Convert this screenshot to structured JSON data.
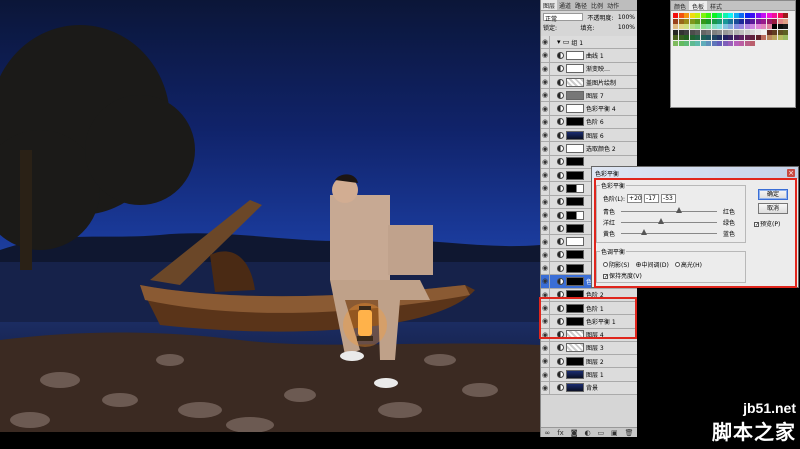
{
  "layers_panel": {
    "tabs": [
      "图层",
      "通道",
      "路径",
      "比例",
      "动作"
    ],
    "blend_mode": "正常",
    "opacity_label": "不透明度:",
    "opacity_value": "100%",
    "lock_label": "锁定:",
    "fill_label": "填充:",
    "fill_value": "100%",
    "layers": [
      {
        "name": "组 1",
        "thumb": "none"
      },
      {
        "name": "曲线 1",
        "thumb": "w"
      },
      {
        "name": "渐变映…",
        "thumb": "w"
      },
      {
        "name": "盖图片绘制",
        "thumb": "chk"
      },
      {
        "name": "图层 7",
        "thumb": "g"
      },
      {
        "name": "色彩平衡 4",
        "thumb": "w"
      },
      {
        "name": "色阶 6",
        "thumb": "b"
      },
      {
        "name": "图层 6",
        "thumb": "img"
      },
      {
        "name": "选取颜色 2",
        "thumb": "w"
      },
      {
        "name": "",
        "thumb": "b"
      },
      {
        "name": "",
        "thumb": "b"
      },
      {
        "name": "",
        "thumb": "mix"
      },
      {
        "name": "",
        "thumb": "b"
      },
      {
        "name": "",
        "thumb": "mix"
      },
      {
        "name": "",
        "thumb": "b"
      },
      {
        "name": "",
        "thumb": "w"
      },
      {
        "name": "",
        "thumb": "b"
      },
      {
        "name": "",
        "thumb": "b"
      },
      {
        "name": "色彩平衡 2",
        "thumb": "b"
      },
      {
        "name": "色阶 2",
        "thumb": "b"
      },
      {
        "name": "色阶 1",
        "thumb": "b"
      },
      {
        "name": "色彩平衡 1",
        "thumb": "b"
      },
      {
        "name": "图层 4",
        "thumb": "chk"
      },
      {
        "name": "图层 3",
        "thumb": "chk"
      },
      {
        "name": "图层 2",
        "thumb": "b"
      },
      {
        "name": "图层 1",
        "thumb": "img"
      },
      {
        "name": "背景",
        "thumb": "img"
      }
    ],
    "selected_index": 18,
    "bottom_icons": [
      "link-icon",
      "fx-icon",
      "mask-icon",
      "adjustment-icon",
      "folder-icon",
      "new-layer-icon",
      "trash-icon"
    ]
  },
  "swatches_panel": {
    "tabs": [
      "颜色",
      "色板",
      "样式"
    ]
  },
  "dialog": {
    "title": "色彩平衡",
    "group_balance": "色彩平衡",
    "levels_label": "色阶(L):",
    "levels": [
      "+20",
      "-17",
      "-53"
    ],
    "sliders": [
      {
        "left": "青色",
        "right": "红色",
        "value": 20
      },
      {
        "left": "洋红",
        "right": "绿色",
        "value": -17
      },
      {
        "left": "黄色",
        "right": "蓝色",
        "value": -53
      }
    ],
    "group_tone": "色调平衡",
    "tones": [
      "阴影(S)",
      "中间调(D)",
      "高光(H)"
    ],
    "tone_selected": 1,
    "preserve_luminosity": "保持亮度(V)",
    "ok": "确定",
    "cancel": "取消",
    "preview": "预览(P)"
  },
  "watermark": {
    "url": "jb51.net",
    "cn": "脚本之家"
  },
  "colors": {
    "accent_red": "#e0261d",
    "selection_blue": "#3a6ed6"
  }
}
